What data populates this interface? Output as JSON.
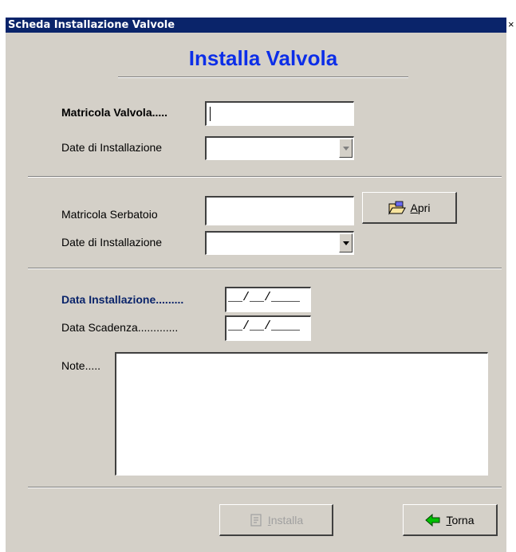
{
  "window": {
    "title": "Scheda Installazione Valvole",
    "close_glyph": "×"
  },
  "heading": "Installa Valvola",
  "valvola": {
    "matricola_label": "Matricola Valvola.....",
    "matricola_value": "",
    "date_label": "Date di Installazione",
    "date_value": ""
  },
  "serbatoio": {
    "matricola_label": "Matricola Serbatoio",
    "matricola_value": "",
    "apri_label_prefix": "",
    "apri_label_underline": "A",
    "apri_label_rest": "pri",
    "date_label": "Date di Installazione",
    "date_value": ""
  },
  "installazione": {
    "data_installazione_label": "Data Installazione.........",
    "data_installazione_value": "__/__/____",
    "data_scadenza_label": "Data Scadenza.............",
    "data_scadenza_value": "__/__/____",
    "note_label": "Note.....",
    "note_value": ""
  },
  "buttons": {
    "installa_underline": "I",
    "installa_rest": "nstalla",
    "torna_underline": "T",
    "torna_rest": "orna"
  },
  "colors": {
    "titlebar": "#0a246a",
    "heading": "#0c2ee8",
    "window_bg": "#d4d0c8",
    "accent_label": "#0a246a",
    "torna_arrow": "#00c000"
  },
  "icons": {
    "apri": "folder-open-icon",
    "installa": "installa-icon",
    "torna": "back-arrow-icon"
  }
}
